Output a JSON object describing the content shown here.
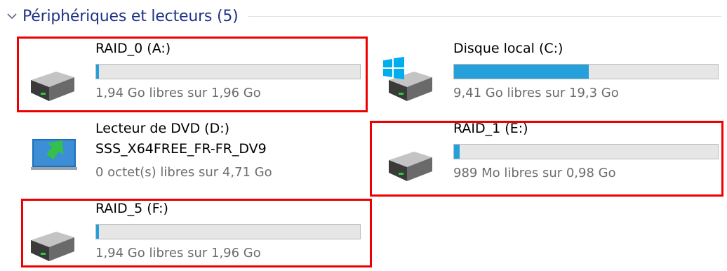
{
  "section": {
    "title": "Périphériques et lecteurs (5)",
    "icon": "chevron-down-icon"
  },
  "colors": {
    "accent": "#26a0da",
    "title": "#1e3287",
    "highlight": "#ee0000",
    "secondary_text": "#6d6d6d"
  },
  "drives": [
    {
      "id": "raid0",
      "name": "RAID_0 (A:)",
      "icon": "hard-drive-icon",
      "used_fraction": 0.01,
      "free_text": "1,94 Go libres sur 1,96 Go",
      "highlighted": true
    },
    {
      "id": "c",
      "name": "Disque local (C:)",
      "icon": "windows-drive-icon",
      "used_fraction": 0.51,
      "free_text": "9,41 Go libres sur 19,3 Go",
      "highlighted": false
    },
    {
      "id": "dvd",
      "name": "Lecteur de DVD (D:)",
      "label": "SSS_X64FREE_FR-FR_DV9",
      "icon": "dvd-drive-icon",
      "free_text": "0 octet(s) libres sur 4,71 Go",
      "highlighted": false
    },
    {
      "id": "raid1",
      "name": "RAID_1 (E:)",
      "icon": "hard-drive-icon",
      "used_fraction": 0.02,
      "free_text": "989 Mo libres sur 0,98 Go",
      "highlighted": true
    },
    {
      "id": "raid5",
      "name": "RAID_5 (F:)",
      "icon": "hard-drive-icon",
      "used_fraction": 0.01,
      "free_text": "1,94 Go libres sur 1,96 Go",
      "highlighted": true
    }
  ]
}
